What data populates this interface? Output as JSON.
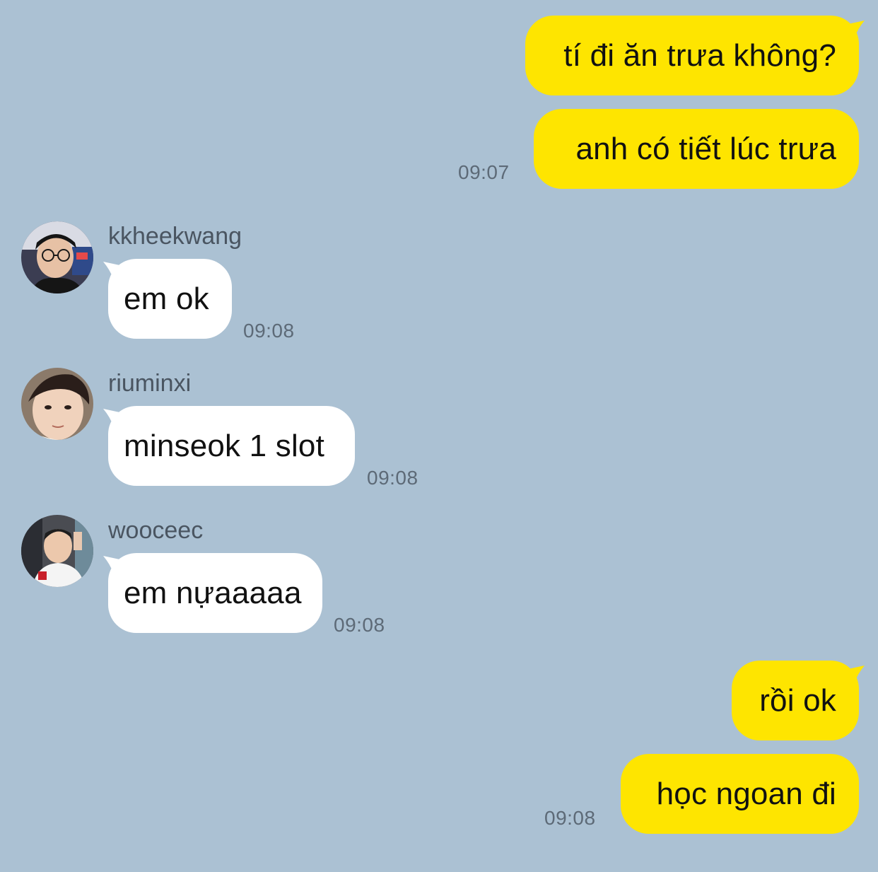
{
  "messages": [
    {
      "from": "me",
      "text": "tí đi ăn trưa không?"
    },
    {
      "from": "me",
      "text": "anh có tiết lúc trưa",
      "time": "09:07"
    },
    {
      "from": "kkheekwang",
      "sender": "kkheekwang",
      "text": "em ok",
      "time": "09:08"
    },
    {
      "from": "riuminxi",
      "sender": "riuminxi",
      "text": "minseok 1 slot",
      "time": "09:08"
    },
    {
      "from": "wooceec",
      "sender": "wooceec",
      "text": "em nựaaaaa",
      "time": "09:08"
    },
    {
      "from": "me",
      "text": "rồi ok"
    },
    {
      "from": "me",
      "text": "học ngoan đi",
      "time": "09:08"
    }
  ],
  "colors": {
    "background": "#abc1d3",
    "my_bubble": "#fee500",
    "their_bubble": "#ffffff",
    "timestamp": "#5d6a77"
  }
}
